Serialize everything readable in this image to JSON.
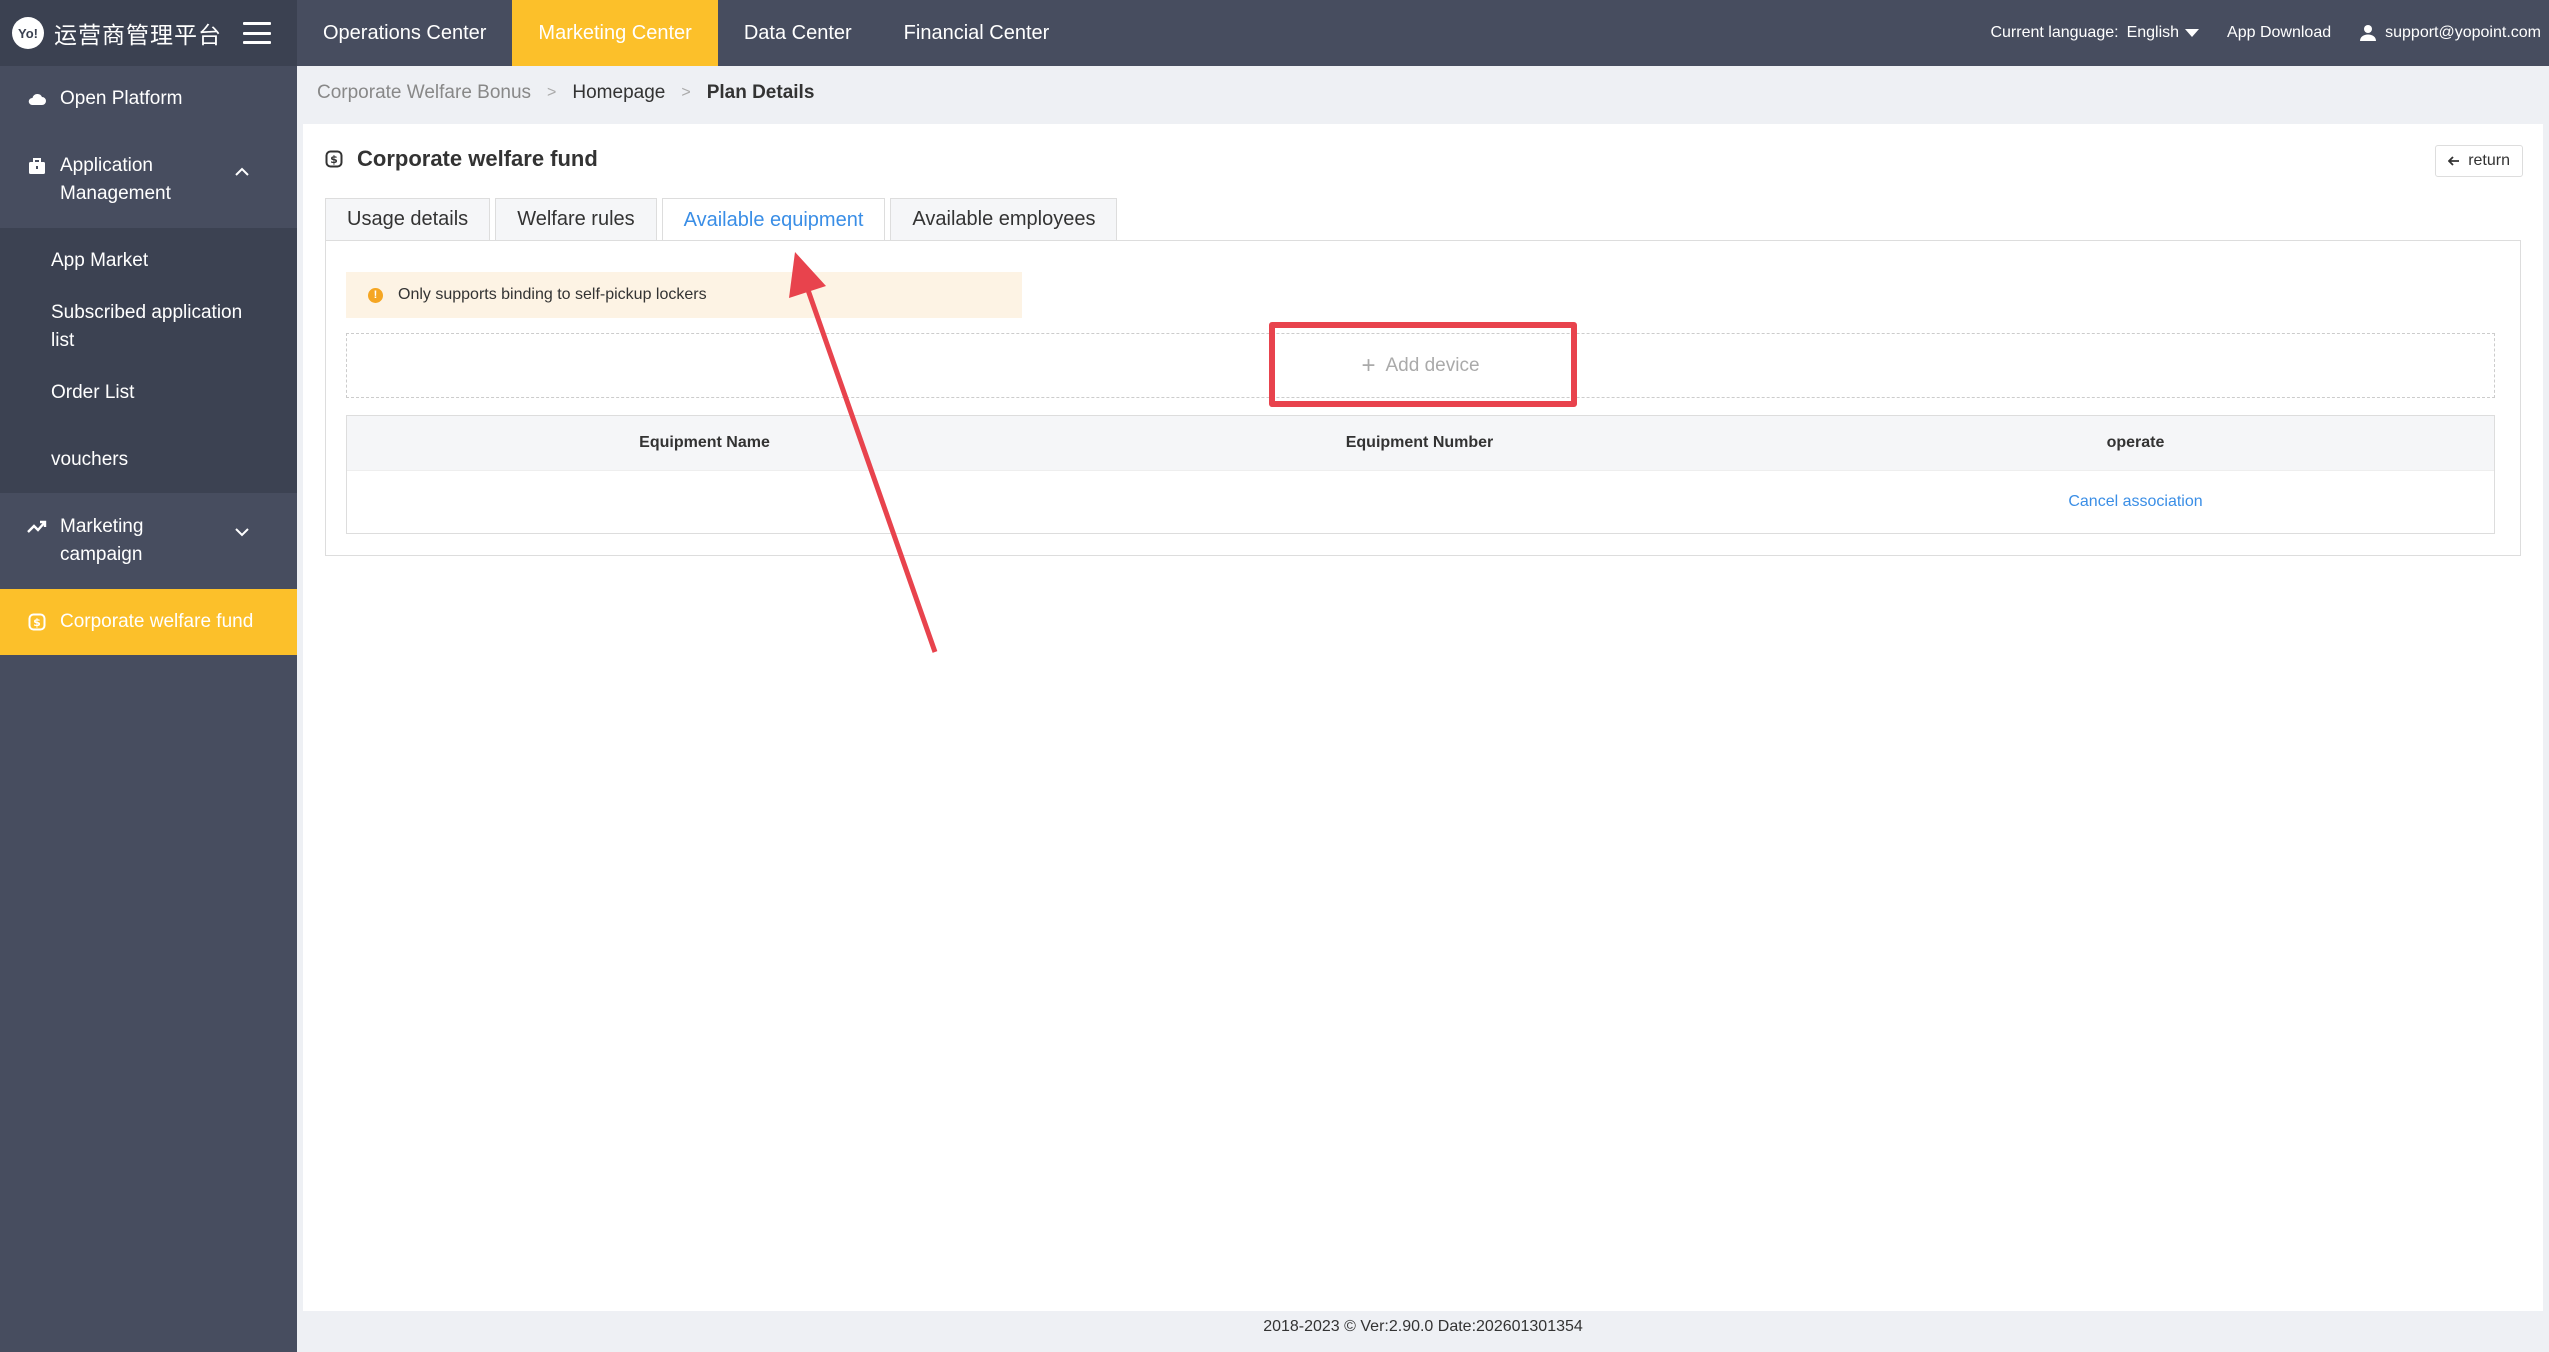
{
  "brand": {
    "logo_badge": "Yo!",
    "title": "运营商管理平台"
  },
  "sidebar": {
    "open_platform": "Open Platform",
    "app_management": "Application Management",
    "app_management_sub": [
      "App Market",
      "Subscribed application list",
      "Order List",
      "vouchers"
    ],
    "marketing_campaign": "Marketing campaign",
    "corporate_welfare": "Corporate welfare fund"
  },
  "topnav": {
    "tabs": [
      "Operations Center",
      "Marketing Center",
      "Data Center",
      "Financial Center"
    ],
    "active_tab": "Marketing Center",
    "language_label": "Current language:",
    "language_value": "English",
    "app_download": "App Download",
    "user_email": "support@yopoint.com"
  },
  "breadcrumb": [
    "Corporate Welfare Bonus",
    "Homepage",
    "Plan Details"
  ],
  "breadcrumb_sep": ">",
  "card": {
    "title": "Corporate welfare fund",
    "return_label": "return",
    "tabs": [
      "Usage details",
      "Welfare rules",
      "Available equipment",
      "Available employees"
    ],
    "active_tab": "Available equipment",
    "notice": "Only supports binding to self-pickup lockers",
    "add_device": "Add device",
    "table": {
      "columns": [
        "Equipment Name",
        "Equipment Number",
        "operate"
      ],
      "rows": [
        {
          "name": "",
          "number": "",
          "action": "Cancel association"
        }
      ]
    }
  },
  "footer": "2018-2023 © Ver:2.90.0 Date:202601301354",
  "colors": {
    "accent": "#fcc02a",
    "nav_bg": "#474d5f",
    "link": "#3a8ee6",
    "annotation": "#e8434d"
  }
}
